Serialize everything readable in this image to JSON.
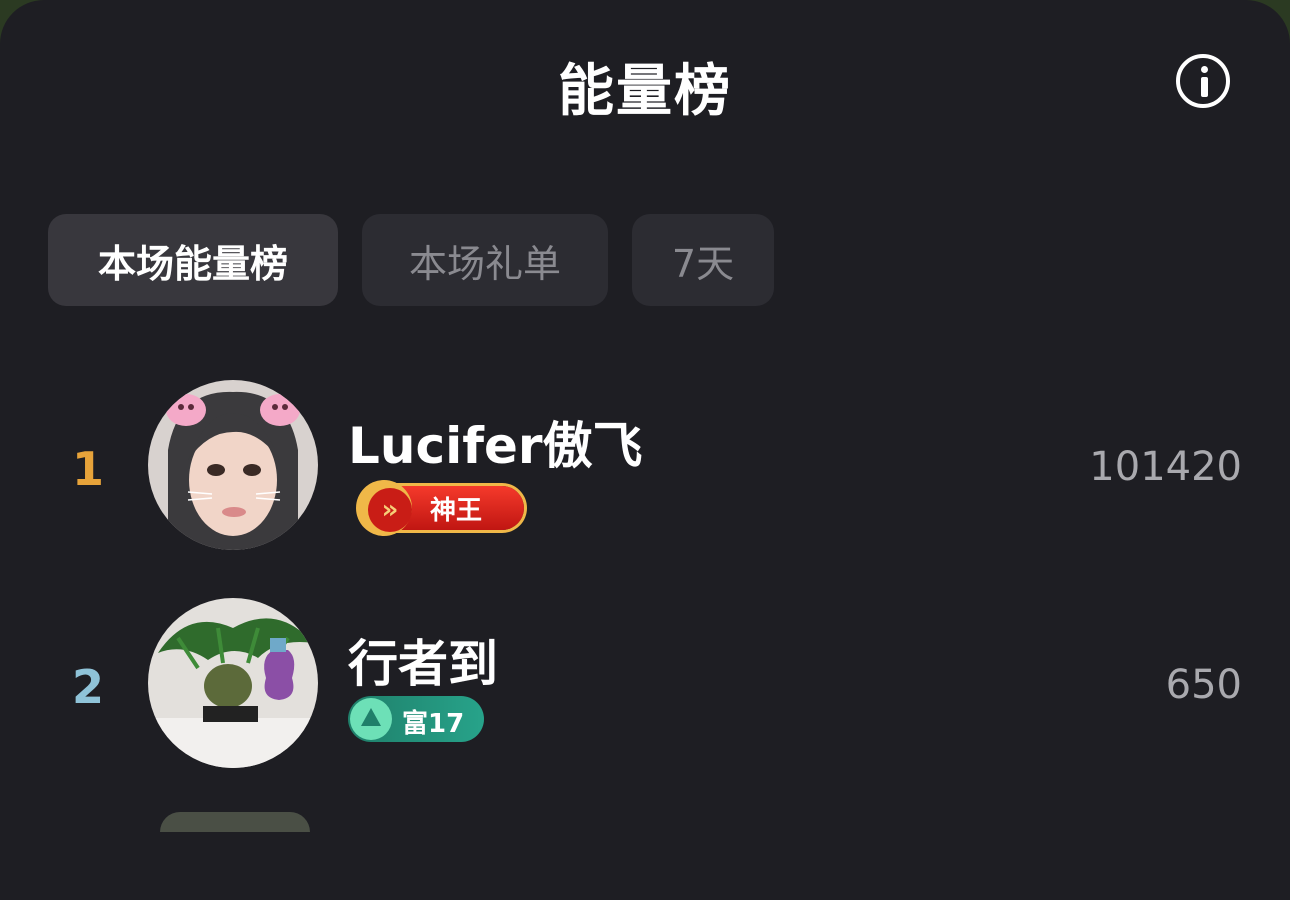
{
  "header": {
    "title": "能量榜",
    "info_icon": "info-icon"
  },
  "tabs": [
    {
      "label": "本场能量榜",
      "active": true
    },
    {
      "label": "本场礼单",
      "active": false
    },
    {
      "label": "7天",
      "active": false
    }
  ],
  "ranking": [
    {
      "rank": "1",
      "rank_color": "#e7a33a",
      "name": "Lucifer傲飞",
      "badge": "神王",
      "badge_icon": "shield-chevron-icon",
      "score": "101420"
    },
    {
      "rank": "2",
      "rank_color": "#8fc3d8",
      "name": "行者到",
      "badge": "富17",
      "badge_icon": "triangle-icon",
      "score": "650"
    }
  ]
}
